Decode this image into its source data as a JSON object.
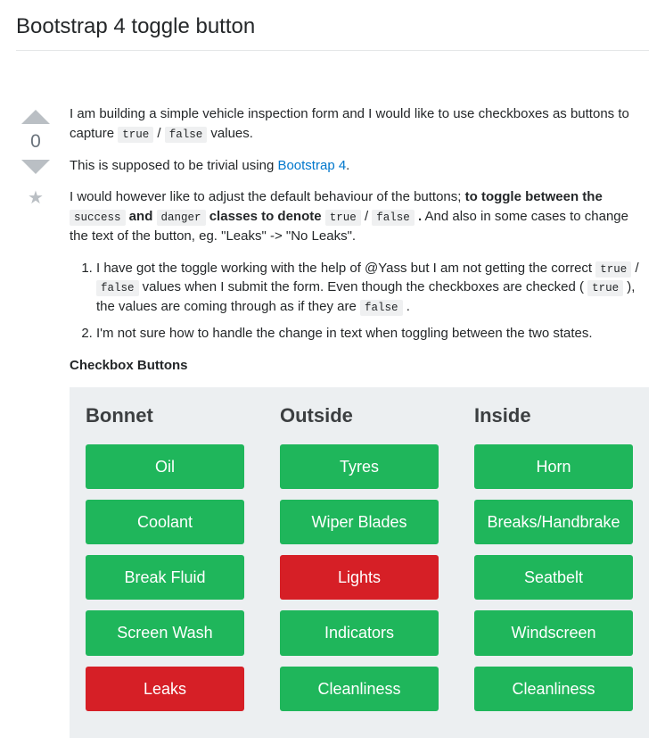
{
  "title": "Bootstrap 4 toggle button",
  "vote": {
    "count": "0"
  },
  "body": {
    "p1_a": "I am building a simple vehicle inspection form and I would like to use checkboxes as buttons to capture ",
    "p1_code1": "true",
    "p1_slash": " / ",
    "p1_code2": "false",
    "p1_b": " values.",
    "p2_a": "This is supposed to be trivial using ",
    "p2_link": "Bootstrap 4",
    "p2_b": ".",
    "p3_a": "I would however like to adjust the default behaviour of the buttons; ",
    "p3_bold1": "to toggle between the ",
    "p3_code1": "success",
    "p3_bold2": " and ",
    "p3_code2": "danger",
    "p3_bold3": " classes to denote ",
    "p3_code3": "true",
    "p3_slash": " / ",
    "p3_code4": "false",
    "p3_bold4": " .",
    "p3_b": " And also in some cases to change the text of the button, eg. \"Leaks\" -> \"No Leaks\".",
    "li1_a": "I have got the toggle working with the help of @Yass but I am not getting the correct ",
    "li1_code1": "true",
    "li1_slash": " / ",
    "li1_code2": "false",
    "li1_b": " values when I submit the form. Even though the checkboxes are checked ( ",
    "li1_code3": "true",
    "li1_c": " ), the values are coming through as if they are ",
    "li1_code4": "false",
    "li1_d": " .",
    "li2": "I'm not sure how to handle the change in text when toggling between the two states.",
    "section_heading": "Checkbox Buttons"
  },
  "demo": {
    "columns": [
      {
        "title": "Bonnet",
        "buttons": [
          {
            "label": "Oil",
            "state": "success"
          },
          {
            "label": "Coolant",
            "state": "success"
          },
          {
            "label": "Break Fluid",
            "state": "success"
          },
          {
            "label": "Screen Wash",
            "state": "success"
          },
          {
            "label": "Leaks",
            "state": "danger"
          }
        ]
      },
      {
        "title": "Outside",
        "buttons": [
          {
            "label": "Tyres",
            "state": "success"
          },
          {
            "label": "Wiper Blades",
            "state": "success"
          },
          {
            "label": "Lights",
            "state": "danger"
          },
          {
            "label": "Indicators",
            "state": "success"
          },
          {
            "label": "Cleanliness",
            "state": "success"
          }
        ]
      },
      {
        "title": "Inside",
        "buttons": [
          {
            "label": "Horn",
            "state": "success"
          },
          {
            "label": "Breaks/Handbrake",
            "state": "success"
          },
          {
            "label": "Seatbelt",
            "state": "success"
          },
          {
            "label": "Windscreen",
            "state": "success"
          },
          {
            "label": "Cleanliness",
            "state": "success"
          }
        ]
      }
    ]
  }
}
